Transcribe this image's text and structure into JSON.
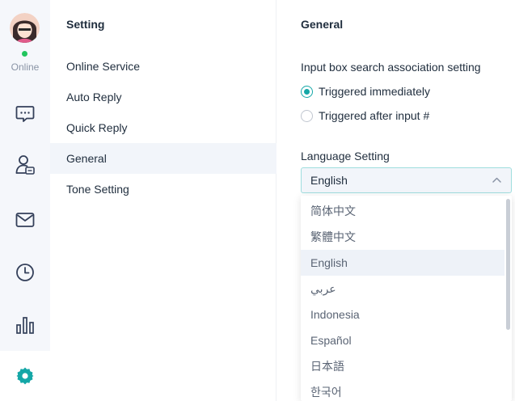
{
  "rail": {
    "status": "Online",
    "status_color": "#22c55e",
    "accent_color": "#14a7a7",
    "icons": [
      "chat-icon",
      "contacts-icon",
      "mail-icon",
      "clock-icon",
      "bar-chart-icon",
      "settings-gear-icon"
    ]
  },
  "menu": {
    "title": "Setting",
    "items": [
      {
        "label": "Online Service"
      },
      {
        "label": "Auto Reply"
      },
      {
        "label": "Quick Reply"
      },
      {
        "label": "General",
        "active": true
      },
      {
        "label": "Tone Setting"
      }
    ]
  },
  "content": {
    "title": "General",
    "search_assoc": {
      "label": "Input box search association setting",
      "options": [
        {
          "label": "Triggered immediately",
          "checked": true
        },
        {
          "label": "Triggered after input #",
          "checked": false
        }
      ]
    },
    "language": {
      "label": "Language Setting",
      "selected": "English",
      "options": [
        "简体中文",
        "繁體中文",
        "English",
        "عربي",
        "Indonesia",
        "Español",
        "日本語",
        "한국어"
      ]
    }
  }
}
